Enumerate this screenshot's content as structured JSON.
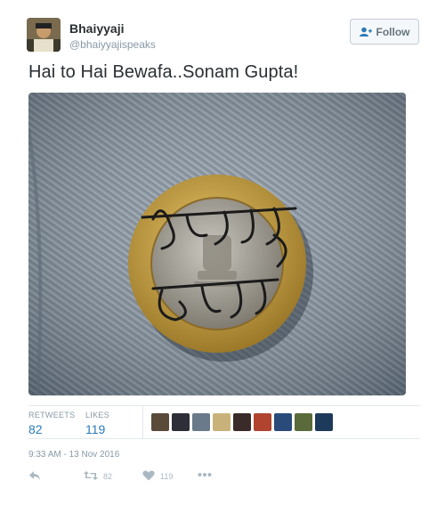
{
  "author": {
    "name": "Bhaiyyaji",
    "handle": "@bhaiyyajispeaks"
  },
  "follow_button": {
    "label": "Follow",
    "icon": "add-user-icon"
  },
  "tweet": {
    "text": "Hai to Hai Bewafa..Sonam Gupta!"
  },
  "photo": {
    "coin_inscription": [
      "सोनम गुप्ता",
      "बेवफ़ा है"
    ]
  },
  "stats": {
    "retweets_label": "RETWEETS",
    "retweets_value": "82",
    "likes_label": "LIKES",
    "likes_value": "119",
    "liker_avatar_colors": [
      "#5a4a3a",
      "#2e2e38",
      "#6a7a8a",
      "#c9b27a",
      "#3a2a2a",
      "#b0442e",
      "#2a4a7a",
      "#5a6a3a",
      "#1e3a5a"
    ]
  },
  "timestamp": "9:33 AM - 13 Nov 2016",
  "actions": {
    "reply_icon": "reply-icon",
    "retweet_icon": "retweet-icon",
    "retweet_count": "82",
    "like_icon": "heart-icon",
    "like_count": "119",
    "more_icon": "more-dots-icon"
  },
  "colors": {
    "link_blue": "#2b7bb9",
    "muted_gray": "#8899a6",
    "text_dark": "#292f33"
  }
}
